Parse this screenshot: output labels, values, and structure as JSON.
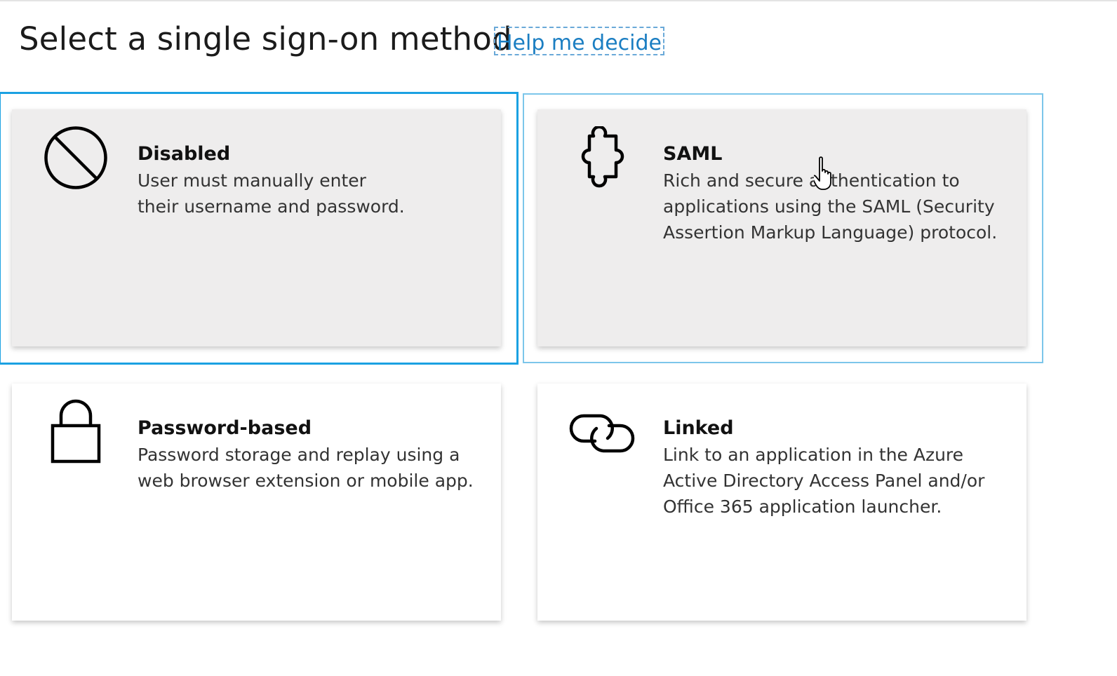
{
  "page": {
    "title": "Select a single sign-on method",
    "help_link": "Help me decide"
  },
  "methods": [
    {
      "title": "Disabled",
      "description": "User must manually enter their username and password.",
      "icon": "prohibited-icon",
      "state": "selected"
    },
    {
      "title": "SAML",
      "description": "Rich and secure authentication to applications using the SAML (Security Assertion Markup Language) protocol.",
      "icon": "puzzle-icon",
      "state": "hovered"
    },
    {
      "title": "Password-based",
      "description": "Password storage and replay using a web browser extension or mobile app.",
      "icon": "lock-icon",
      "state": "default"
    },
    {
      "title": "Linked",
      "description": "Link to an application in the Azure Active Directory Access Panel and/or Office 365 application launcher.",
      "icon": "link-icon",
      "state": "default"
    }
  ],
  "colors": {
    "selected_border": "#1ba1e2",
    "hover_border": "#7cc6ea",
    "link": "#1b7ec2",
    "hover_card": "#eeeded"
  },
  "cursor": "hand-pointer-icon"
}
